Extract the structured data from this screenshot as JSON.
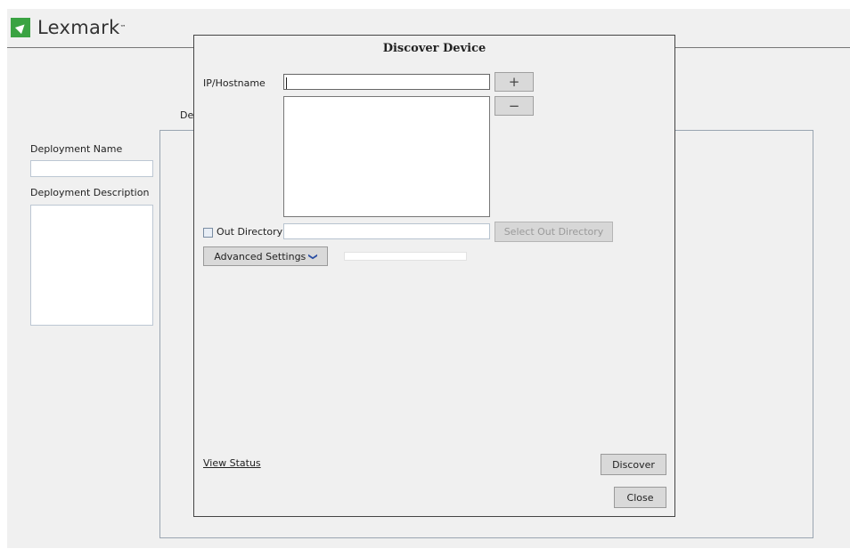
{
  "app": {
    "brand": "Lexmark",
    "brand_tm": "™"
  },
  "background": {
    "deployment_name_label": "Deployment Name",
    "deployment_name_value": "",
    "deployment_description_label": "Deployment Description",
    "deployment_description_value": "",
    "partial_label": "De"
  },
  "dialog": {
    "title": "Discover Device",
    "ip_label": "IP/Hostname",
    "ip_value": "",
    "add_symbol": "+",
    "remove_symbol": "−",
    "hosts": [],
    "out_directory_label": "Out Directory",
    "out_directory_checked": false,
    "out_directory_value": "",
    "select_out_directory_label": "Select Out Directory",
    "advanced_settings_label": "Advanced Settings",
    "advanced_settings_chevron": "❯",
    "view_status_label": "View Status",
    "discover_label": "Discover",
    "close_label": "Close"
  },
  "colors": {
    "brand_green": "#3aa342",
    "chevron_blue": "#2b4fa3"
  },
  "icons": {
    "logo": "lexmark-logo-icon",
    "chevron": "chevron-down-icon",
    "add": "plus-icon",
    "remove": "minus-icon"
  }
}
